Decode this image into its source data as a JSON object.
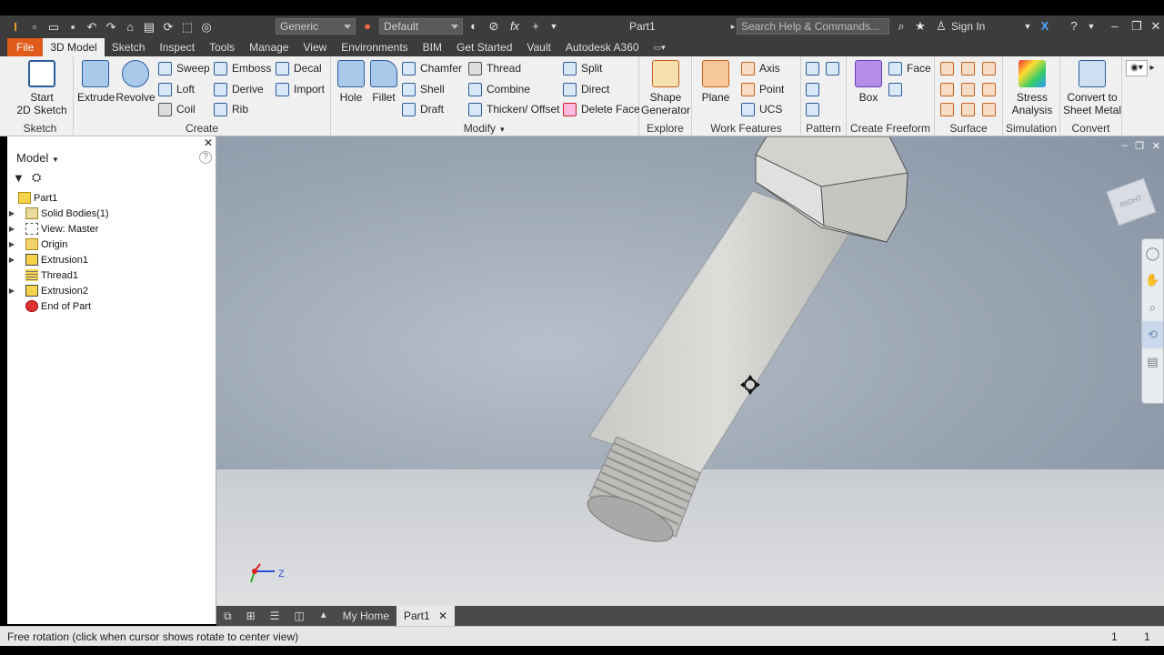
{
  "title_bar": {
    "appearance_value": "Generic",
    "material_value": "Default",
    "document_title": "Part1",
    "search_placeholder": "Search Help & Commands...",
    "sign_in_label": "Sign In"
  },
  "menu_tabs": [
    "File",
    "3D Model",
    "Sketch",
    "Inspect",
    "Tools",
    "Manage",
    "View",
    "Environments",
    "BIM",
    "Get Started",
    "Vault",
    "Autodesk A360"
  ],
  "active_tab": "3D Model",
  "ribbon": {
    "sketch": {
      "label": "Sketch",
      "start": "Start",
      "start2": "2D Sketch"
    },
    "create": {
      "label": "Create",
      "extrude": "Extrude",
      "revolve": "Revolve",
      "sweep": "Sweep",
      "loft": "Loft",
      "coil": "Coil",
      "emboss": "Emboss",
      "derive": "Derive",
      "rib": "Rib",
      "decal": "Decal",
      "import": "Import"
    },
    "modify": {
      "label": "Modify",
      "hole": "Hole",
      "fillet": "Fillet",
      "chamfer": "Chamfer",
      "shell": "Shell",
      "draft": "Draft",
      "thread": "Thread",
      "combine": "Combine",
      "thicken": "Thicken/ Offset",
      "split": "Split",
      "direct": "Direct",
      "delete_face": "Delete Face"
    },
    "explore": {
      "label": "Explore",
      "shape": "Shape",
      "generator": "Generator"
    },
    "work_features": {
      "label": "Work Features",
      "plane": "Plane",
      "axis": "Axis",
      "point": "Point",
      "ucs": "UCS"
    },
    "pattern": {
      "label": "Pattern"
    },
    "create_freeform": {
      "label": "Create Freeform",
      "box": "Box",
      "face": "Face"
    },
    "surface": {
      "label": "Surface"
    },
    "simulation": {
      "label": "Simulation",
      "stress": "Stress",
      "analysis": "Analysis"
    },
    "convert": {
      "label": "Convert",
      "convert_to": "Convert to",
      "sheet_metal": "Sheet Metal"
    }
  },
  "browser": {
    "header": "Model",
    "items": [
      {
        "label": "Part1",
        "expandable": false,
        "icon": "part-icon"
      },
      {
        "label": "Solid Bodies(1)",
        "expandable": true,
        "icon": "solid-bodies-icon"
      },
      {
        "label": "View: Master",
        "expandable": true,
        "icon": "view-icon"
      },
      {
        "label": "Origin",
        "expandable": true,
        "icon": "folder-icon"
      },
      {
        "label": "Extrusion1",
        "expandable": true,
        "icon": "extrusion-icon"
      },
      {
        "label": "Thread1",
        "expandable": false,
        "icon": "thread-icon"
      },
      {
        "label": "Extrusion2",
        "expandable": true,
        "icon": "extrusion-icon"
      },
      {
        "label": "End of Part",
        "expandable": false,
        "icon": "end-of-part-icon"
      }
    ]
  },
  "viewcube_label": "RIGHT",
  "doc_tabs": [
    "My Home",
    "Part1"
  ],
  "status": {
    "text": "Free rotation (click when cursor shows rotate to center view)",
    "count1": "1",
    "count2": "1"
  },
  "colors": {
    "file_tab": "#e05a1a",
    "accent_blue": "#2b5d9e",
    "ribbon_bg": "#f0f0f0",
    "title_bg": "#3c3c3c"
  }
}
